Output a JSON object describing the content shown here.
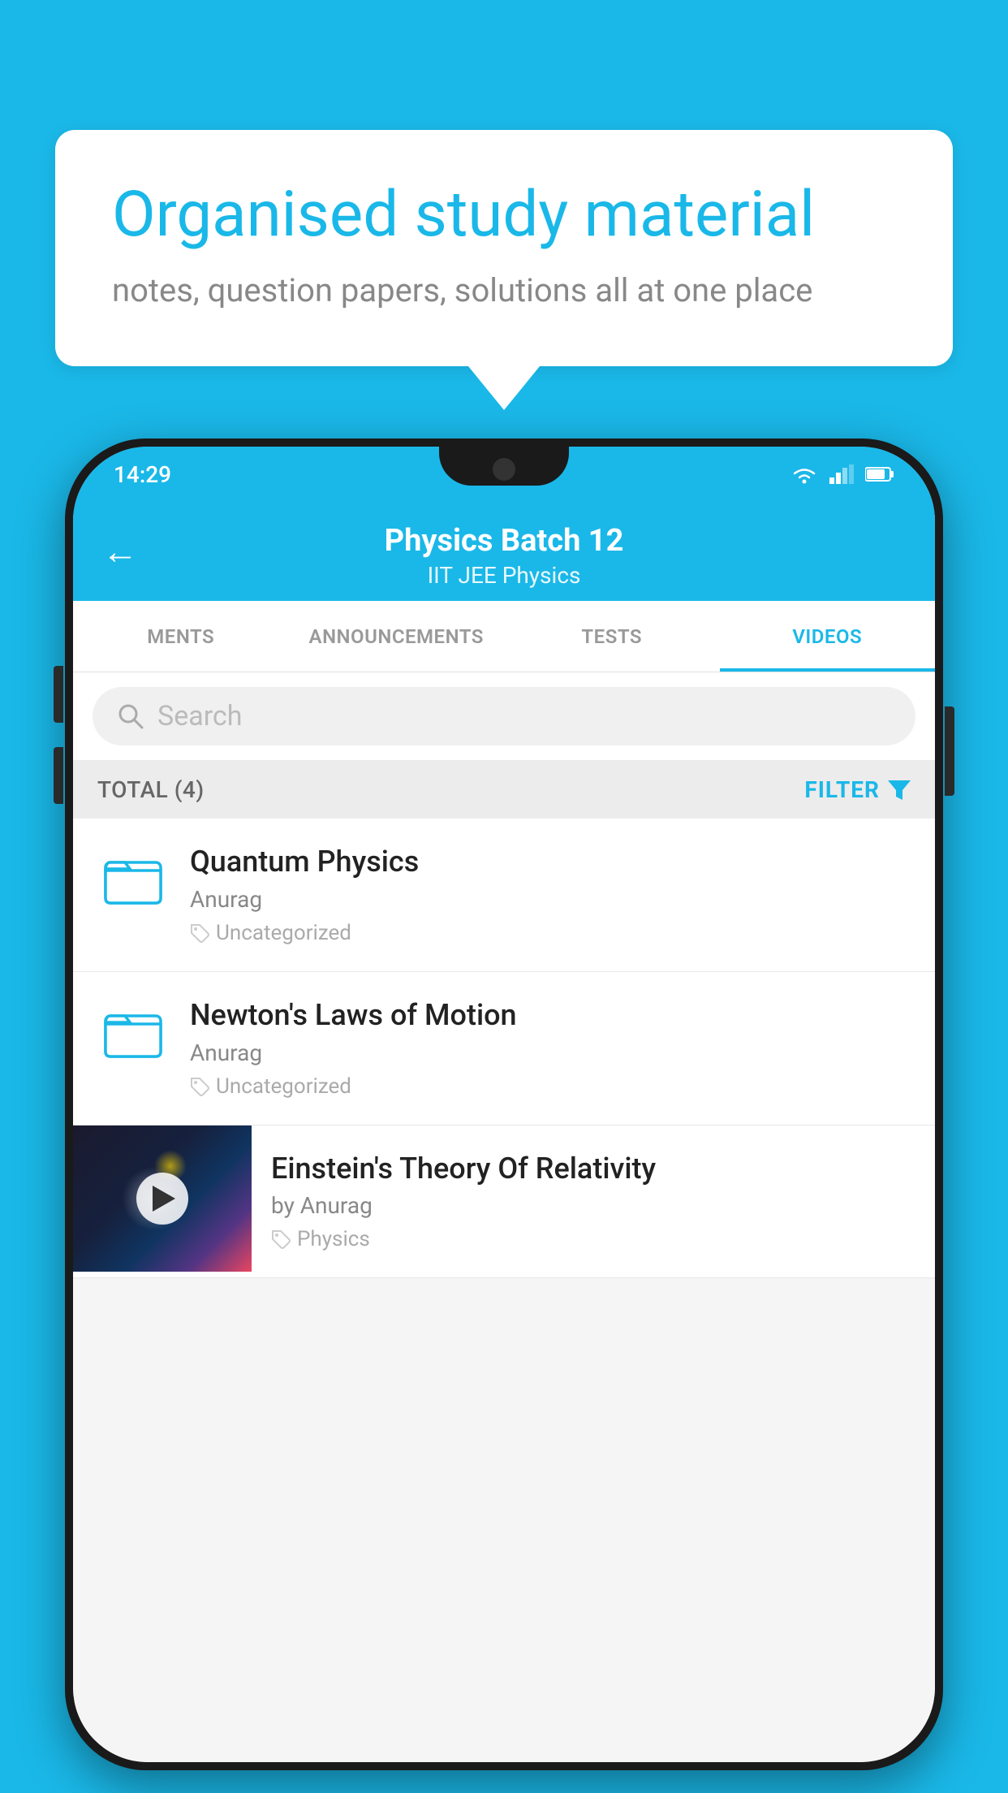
{
  "background_color": "#1ab8e8",
  "speech_bubble": {
    "title": "Organised study material",
    "subtitle": "notes, question papers, solutions all at one place"
  },
  "status_bar": {
    "time": "14:29"
  },
  "app_header": {
    "title": "Physics Batch 12",
    "subtitle": "IIT JEE   Physics",
    "back_label": "←"
  },
  "tabs": [
    {
      "label": "MENTS",
      "active": false
    },
    {
      "label": "ANNOUNCEMENTS",
      "active": false
    },
    {
      "label": "TESTS",
      "active": false
    },
    {
      "label": "VIDEOS",
      "active": true
    }
  ],
  "search": {
    "placeholder": "Search"
  },
  "filter_bar": {
    "total_label": "TOTAL (4)",
    "filter_label": "FILTER"
  },
  "videos": [
    {
      "title": "Quantum Physics",
      "author": "Anurag",
      "tag": "Uncategorized",
      "has_thumbnail": false
    },
    {
      "title": "Newton's Laws of Motion",
      "author": "Anurag",
      "tag": "Uncategorized",
      "has_thumbnail": false
    },
    {
      "title": "Einstein's Theory Of Relativity",
      "author": "by Anurag",
      "tag": "Physics",
      "has_thumbnail": true
    }
  ]
}
